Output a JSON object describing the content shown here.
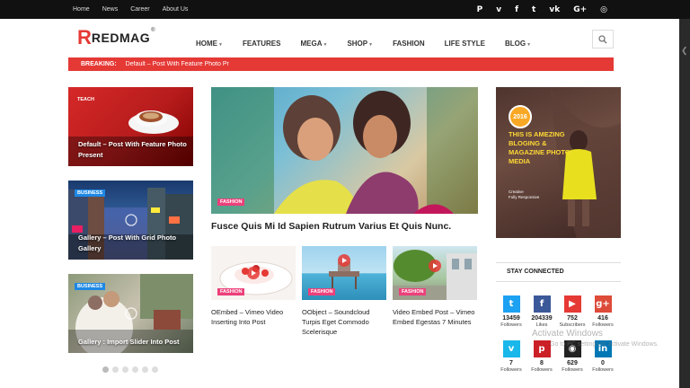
{
  "topbar": {
    "links": [
      "Home",
      "News",
      "Career",
      "About Us"
    ],
    "social_icons": [
      "pinterest-icon",
      "vimeo-icon",
      "facebook-icon",
      "twitter-icon",
      "vk-icon",
      "google-plus-icon",
      "instagram-icon"
    ]
  },
  "logo": {
    "first_letter": "R",
    "rest": "REDMAG",
    "mark": "®"
  },
  "nav": {
    "items": [
      {
        "label": "HOME",
        "dropdown": true
      },
      {
        "label": "FEATURES",
        "dropdown": false
      },
      {
        "label": "MEGA",
        "dropdown": true
      },
      {
        "label": "SHOP",
        "dropdown": true
      },
      {
        "label": "FASHION",
        "dropdown": false
      },
      {
        "label": "LIFE STYLE",
        "dropdown": false
      },
      {
        "label": "BLOG",
        "dropdown": true
      }
    ]
  },
  "breaking": {
    "label": "BREAKING:",
    "text": "Default – Post With Feature Photo Pr"
  },
  "left_cards": [
    {
      "category": "TEACH",
      "title": "Default – Post With Feature Photo Present"
    },
    {
      "category": "BUSINESS",
      "title": "Gallery – Post With Grid Photo Gallery"
    },
    {
      "category": "BUSINESS",
      "title": "Gallery : Import Slider Into Post"
    }
  ],
  "featured": {
    "category": "FASHION",
    "title": "Fusce Quis Mi Id Sapien Rutrum Varius Et Quis Nunc."
  },
  "small_posts": [
    {
      "category": "FASHION",
      "title": "OEmbed – Vimeo Video Inserting Into Post"
    },
    {
      "category": "FASHION",
      "title": "OObject – Soundcloud Turpis Eget Commodo Scelerisque"
    },
    {
      "category": "FASHION",
      "title": "Video Embed Post – Vimeo Embed Egestas 7 Minutes"
    }
  ],
  "ad": {
    "year": "2016",
    "headline": "THIS IS AMEZING BLOGING & MAGAZINE PHOTO MEDIA",
    "small_lines": [
      "Creative",
      "Fully Responsive"
    ]
  },
  "stay_connected": {
    "heading": "STAY CONNECTED",
    "items": [
      {
        "icon": "twitter-icon",
        "glyph": "t",
        "color": "#1da1f2",
        "count": "13459",
        "label": "Followers"
      },
      {
        "icon": "facebook-icon",
        "glyph": "f",
        "color": "#3b5998",
        "count": "204339",
        "label": "Likes"
      },
      {
        "icon": "youtube-icon",
        "glyph": "▶",
        "color": "#e53935",
        "count": "752",
        "label": "Subscribers"
      },
      {
        "icon": "google-plus-icon",
        "glyph": "g+",
        "color": "#dd4b39",
        "count": "416",
        "label": "Followers"
      },
      {
        "icon": "vimeo-icon",
        "glyph": "v",
        "color": "#1ab7ea",
        "count": "7",
        "label": "Followers"
      },
      {
        "icon": "pinterest-icon",
        "glyph": "p",
        "color": "#cb2027",
        "count": "8",
        "label": "Followers"
      },
      {
        "icon": "github-icon",
        "glyph": "◉",
        "color": "#222222",
        "count": "629",
        "label": "Followers"
      },
      {
        "icon": "linkedin-icon",
        "glyph": "in",
        "color": "#0077b5",
        "count": "0",
        "label": "Followers"
      }
    ]
  },
  "watermark": {
    "title": "Activate Windows",
    "subtitle": "Go to PC settings to activate Windows."
  }
}
